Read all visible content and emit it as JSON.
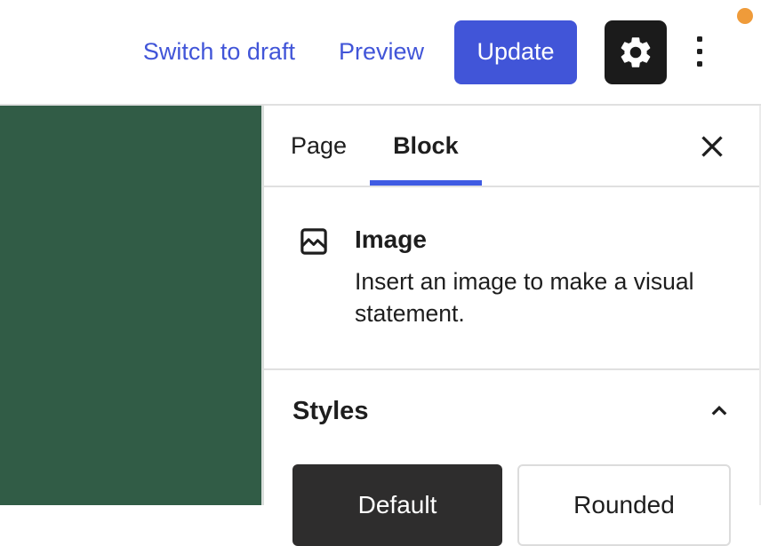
{
  "header": {
    "links": [
      {
        "label": "Switch to draft"
      },
      {
        "label": "Preview"
      }
    ],
    "update_button": "Update",
    "settings_icon": "gear-icon",
    "more_icon": "kebab-menu-icon",
    "unsaved_indicator": "orange-dot"
  },
  "panel": {
    "tabs": [
      {
        "label": "Page",
        "active": false
      },
      {
        "label": "Block",
        "active": true
      }
    ],
    "close_icon": "close-icon",
    "block_card": {
      "icon": "image-block-icon",
      "title": "Image",
      "description": "Insert an image to make a visual statement."
    },
    "styles": {
      "title": "Styles",
      "expanded": true,
      "options": [
        {
          "label": "Default",
          "selected": true
        },
        {
          "label": "Rounded",
          "selected": false
        }
      ]
    }
  },
  "colors": {
    "accent_blue": "#4155d8",
    "tab_underline_blue": "#3f5be3",
    "canvas_green": "#315c46",
    "selected_style_dark": "#2e2d2d",
    "icon_dark": "#1e1e1e",
    "border_gray": "#e0e0e0",
    "unsaved_orange": "#ef9b3a"
  }
}
